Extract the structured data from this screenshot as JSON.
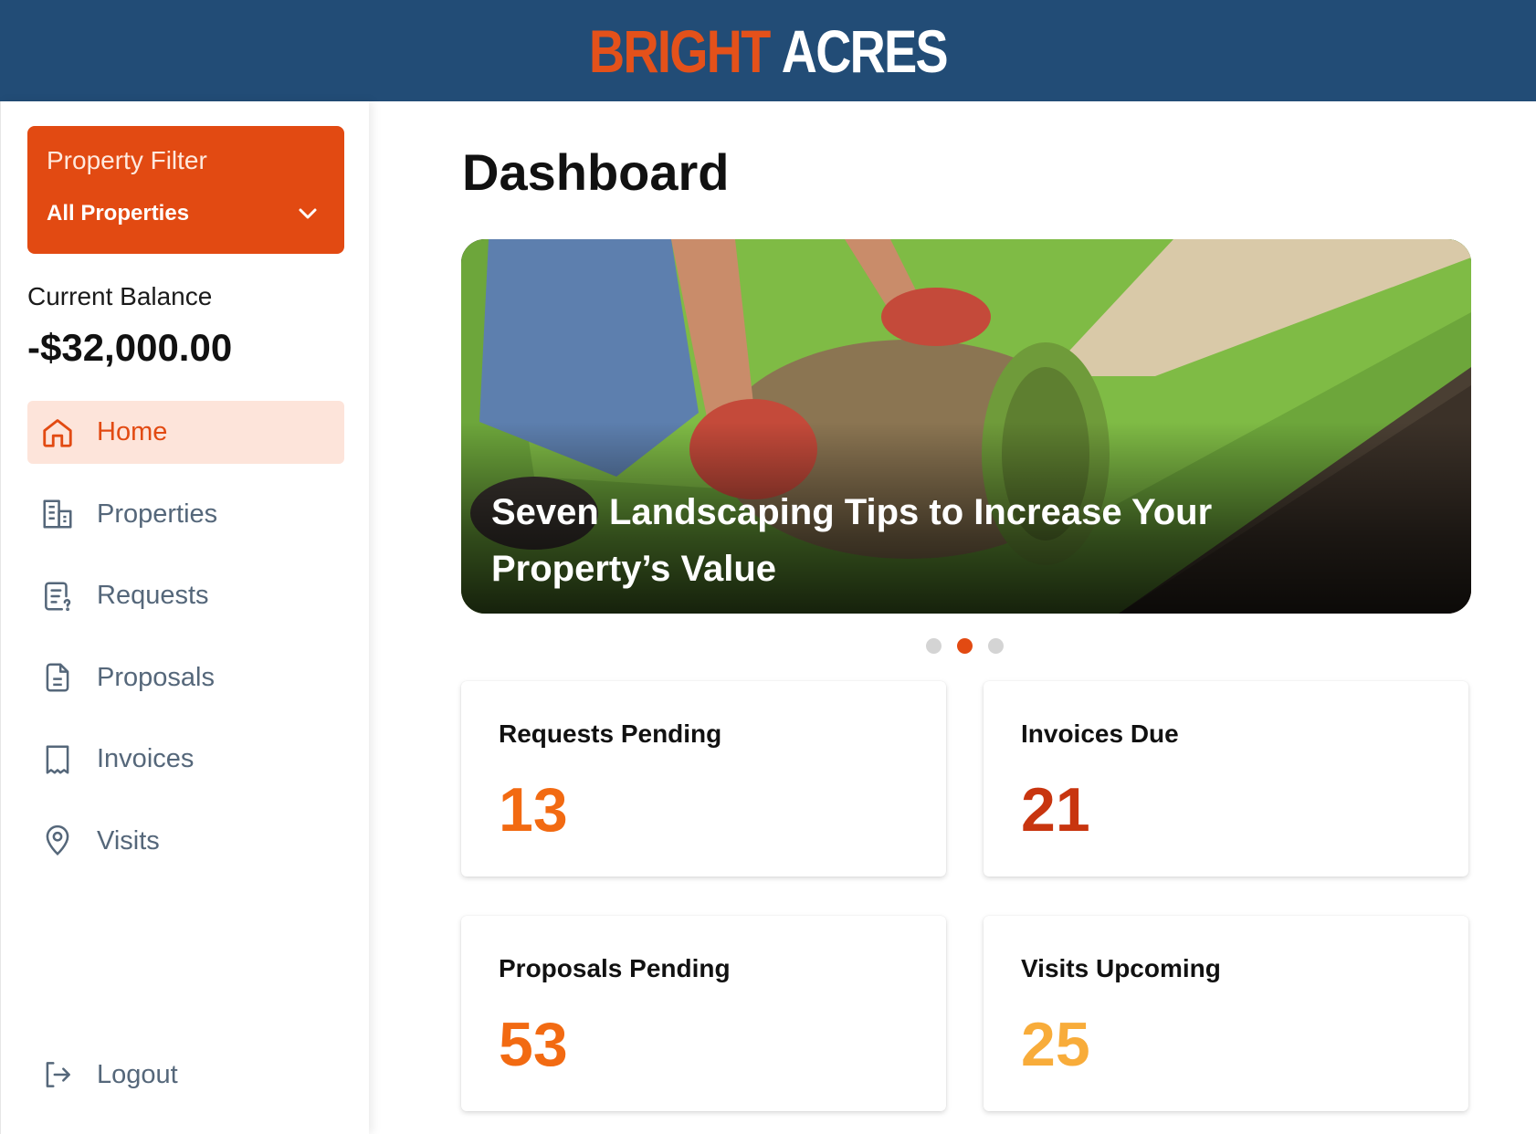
{
  "brand": {
    "word1": "BRIGHT",
    "word2": "ACRES"
  },
  "sidebar": {
    "filter": {
      "label": "Property Filter",
      "value": "All Properties"
    },
    "balance": {
      "label": "Current Balance",
      "value": "-$32,000.00"
    },
    "nav": [
      {
        "label": "Home",
        "icon": "home-icon",
        "active": true
      },
      {
        "label": "Properties",
        "icon": "building-icon"
      },
      {
        "label": "Requests",
        "icon": "request-icon"
      },
      {
        "label": "Proposals",
        "icon": "document-icon"
      },
      {
        "label": "Invoices",
        "icon": "receipt-icon"
      },
      {
        "label": "Visits",
        "icon": "map-pin-icon"
      }
    ],
    "logout": {
      "label": "Logout",
      "icon": "logout-icon"
    }
  },
  "main": {
    "title": "Dashboard",
    "hero": {
      "caption_line1": "Seven Landscaping Tips to Increase Your",
      "caption_line2": "Property’s Value",
      "active_slide": 2,
      "slide_count": 3
    },
    "stats": [
      {
        "title": "Requests Pending",
        "value": "13",
        "color": "#f26a12"
      },
      {
        "title": "Invoices Due",
        "value": "21",
        "color": "#c8350f"
      },
      {
        "title": "Proposals Pending",
        "value": "53",
        "color": "#f26a12"
      },
      {
        "title": "Visits Upcoming",
        "value": "25",
        "color": "#f8ac3a"
      }
    ]
  },
  "colors": {
    "header": "#224c76",
    "accent": "#e24a12",
    "nav_active_bg": "#fde4da",
    "nav_text": "#55677a"
  }
}
